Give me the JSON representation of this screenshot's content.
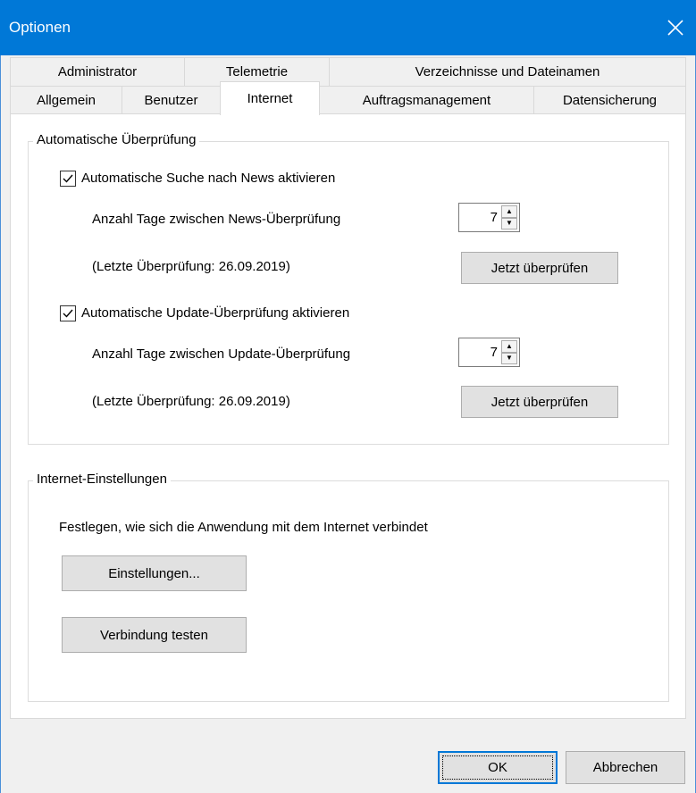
{
  "window": {
    "title": "Optionen",
    "close_icon": "close-icon"
  },
  "tabs": {
    "row_back": [
      "Administrator",
      "Telemetrie",
      "Verzeichnisse und Dateinamen"
    ],
    "row_front": [
      "Allgemein",
      "Benutzer",
      "Internet",
      "Auftragsmanagement",
      "Datensicherung"
    ],
    "active": "Internet"
  },
  "auto_check": {
    "legend": "Automatische Überprüfung",
    "news": {
      "checkbox_label": "Automatische Suche nach News aktivieren",
      "checked": true,
      "days_label": "Anzahl Tage zwischen News-Überprüfung",
      "days_value": "7",
      "last_check": "(Letzte Überprüfung: 26.09.2019)",
      "check_now": "Jetzt überprüfen"
    },
    "update": {
      "checkbox_label": "Automatische Update-Überprüfung aktivieren",
      "checked": true,
      "days_label": "Anzahl Tage zwischen Update-Überprüfung",
      "days_value": "7",
      "last_check": "(Letzte Überprüfung: 26.09.2019)",
      "check_now": "Jetzt überprüfen"
    }
  },
  "internet_settings": {
    "legend": "Internet-Einstellungen",
    "description": "Festlegen, wie sich die Anwendung mit dem Internet verbindet",
    "settings_button": "Einstellungen...",
    "test_button": "Verbindung testen"
  },
  "footer": {
    "ok": "OK",
    "cancel": "Abbrechen"
  },
  "colors": {
    "titlebar": "#0078d7",
    "background": "#f0f0f0",
    "page": "#ffffff",
    "button": "#e1e1e1"
  }
}
